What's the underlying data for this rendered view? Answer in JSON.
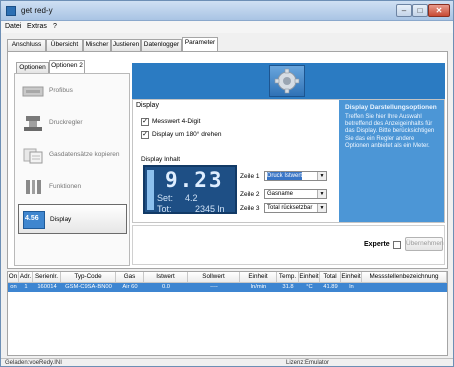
{
  "window": {
    "title": "get red-y"
  },
  "menu": [
    {
      "label": "Datei"
    },
    {
      "label": "Extras"
    },
    {
      "label": "?"
    }
  ],
  "main_tabs": [
    {
      "label": "Anschluss"
    },
    {
      "label": "Übersicht"
    },
    {
      "label": "Mischer"
    },
    {
      "label": "Justieren"
    },
    {
      "label": "Datenlogger"
    },
    {
      "label": "Parameter",
      "active": true
    }
  ],
  "sub_tabs": [
    {
      "label": "Optionen 1"
    },
    {
      "label": "Optionen 2",
      "active": true
    }
  ],
  "options": [
    {
      "label": "Profibus",
      "icon": "profibus-icon"
    },
    {
      "label": "Druckregler",
      "icon": "pressure-regulator-icon"
    },
    {
      "label": "Gasdatensätze kopieren",
      "icon": "copy-gas-data-icon"
    },
    {
      "label": "Funktionen",
      "icon": "functions-icon"
    },
    {
      "label": "Display",
      "icon": "display-icon",
      "icon_text": "4.56",
      "active": true
    }
  ],
  "display": {
    "heading": "Display",
    "checkbox_4digit": {
      "label": "Messwert 4-Digit",
      "checked": true
    },
    "checkbox_rotate": {
      "label": "Display um 180° drehen",
      "checked": true
    },
    "inhalt_label": "Display Inhalt",
    "lcd": {
      "value": "9.23",
      "set_label": "Set:",
      "set_value": "4.2",
      "tot_label": "Tot:",
      "tot_value": "2345 ln"
    },
    "zeilen": [
      {
        "label": "Zeile 1",
        "value": "Druck Istwert",
        "focused": true
      },
      {
        "label": "Zeile 2",
        "value": "Gasname"
      },
      {
        "label": "Zeile 3",
        "value": "Total rücksetzbar"
      }
    ]
  },
  "info": {
    "title": "Display Darstellungsoptionen",
    "text": "Treffen Sie hier Ihre Auswahl betreffend des Anzeigeinhalts für das Display. Bitte berücksichtigen Sie das ein Regler andere Optionen anbietet als ein Meter."
  },
  "footer": {
    "experte_label": "Experte",
    "experte_checked": false,
    "uebernehmen_label": "Übernehmen"
  },
  "table": {
    "columns": [
      "On",
      "Adr.",
      "Serienlr.",
      "Typ-Code",
      "Gas",
      "Istwert",
      "Sollwert",
      "Einheit",
      "Temp.",
      "Einheit",
      "Total",
      "Einheit",
      "Messstellenbezeichnung"
    ],
    "rows": [
      [
        "on",
        "1",
        "160014",
        "GSM-C9SA-BN00",
        "Air 60",
        "0.0",
        "----",
        "ln/min",
        "31.8",
        "°C",
        "41.89",
        "ln",
        ""
      ]
    ]
  },
  "status": {
    "left": "Geladen:voeRedy.INI",
    "right": "Lizenz:Emulator"
  },
  "colors": {
    "accent_blue": "#2b7bc2",
    "info_blue": "#4c96d6",
    "selection_blue": "#3d85d1"
  }
}
